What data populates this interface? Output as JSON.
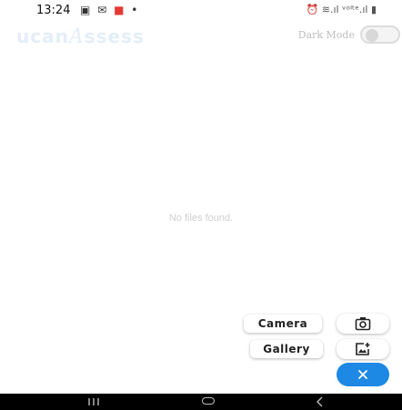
{
  "status_bar": {
    "time": "13:24",
    "left_icons": [
      "gallery-icon",
      "mail-icon",
      "app-notification-icon",
      "dot"
    ],
    "right_icons": [
      "alarm-icon",
      "wifi-icon",
      "signal-icon",
      "volte-signal-icon",
      "battery-icon"
    ],
    "right_text": "⏰ ≋.ıl ᵛᵒˡᵗᵉ.ıl ▮"
  },
  "header": {
    "logo_part1": "ucan",
    "logo_a": "A",
    "logo_part2": "ssess",
    "dark_mode_label": "Dark Mode",
    "dark_mode_on": false
  },
  "main": {
    "empty_message": "No files found."
  },
  "fab_menu": {
    "camera_label": "Camera",
    "gallery_label": "Gallery",
    "camera_icon": "camera-icon",
    "gallery_icon": "add-photo-icon",
    "close_icon": "close-icon",
    "accent_color": "#1e88e5"
  },
  "nav_bar": {
    "buttons": [
      "recent-apps",
      "home",
      "back"
    ]
  }
}
